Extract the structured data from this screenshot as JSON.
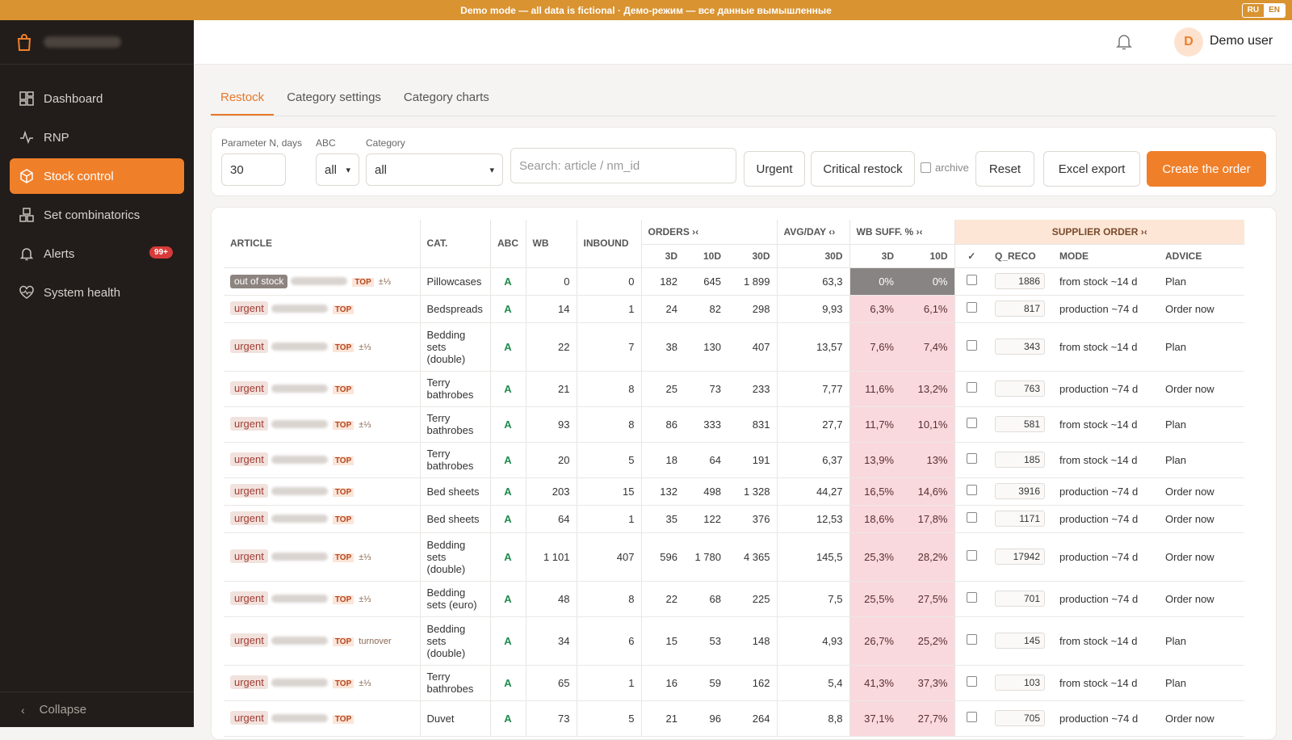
{
  "banner": {
    "text": "Demo mode — all data is fictional · Демо-режим — все данные вымышленные",
    "lang_ru": "RU",
    "lang_en": "EN"
  },
  "sidebar": {
    "items": [
      {
        "label": "Dashboard",
        "icon": "dashboard-icon"
      },
      {
        "label": "RNP",
        "icon": "activity-icon"
      },
      {
        "label": "Stock control",
        "icon": "box-icon",
        "active": true
      },
      {
        "label": "Set combinatorics",
        "icon": "boxes-icon"
      },
      {
        "label": "Alerts",
        "icon": "bell-icon",
        "badge": "99+"
      },
      {
        "label": "System health",
        "icon": "heart-pulse-icon"
      }
    ],
    "collapse": "Collapse"
  },
  "header": {
    "avatar_letter": "D",
    "user_name": "Demo user"
  },
  "tabs": [
    "Restock",
    "Category settings",
    "Category charts"
  ],
  "filters": {
    "param_label": "Parameter N, days",
    "param_value": "30",
    "abc_label": "ABC",
    "abc_value": "all",
    "category_label": "Category",
    "category_value": "all",
    "search_placeholder": "Search: article / nm_id",
    "urgent": "Urgent",
    "critical": "Critical restock",
    "archive": "archive",
    "reset": "Reset",
    "export": "Excel export",
    "create": "Create the order"
  },
  "table": {
    "headers": {
      "article": "ARTICLE",
      "cat": "CAT.",
      "abc": "ABC",
      "wb": "WB",
      "inbound": "INBOUND",
      "orders": "ORDERS ›‹",
      "avg": "AVG/DAY ‹›",
      "suff": "WB SUFF. % ›‹",
      "supplier": "SUPPLIER ORDER ›‹",
      "d3": "3D",
      "d10": "10D",
      "d30": "30D",
      "a30": "30D",
      "s3": "3D",
      "s10": "10D",
      "check": "✓",
      "qreco": "Q_RECO",
      "mode": "MODE",
      "advice": "ADVICE"
    },
    "rows": [
      {
        "status": "out of stock",
        "extra": "±⅓",
        "cat": "Pillowcases",
        "abc": "A",
        "wb": "0",
        "inbound": "0",
        "o3": "182",
        "o10": "645",
        "o30": "1 899",
        "avg": "63,3",
        "s3": "0%",
        "s10": "0%",
        "q": "1886",
        "mode": "from stock ~14 d",
        "advice": "Plan"
      },
      {
        "status": "urgent",
        "extra": "",
        "cat": "Bedspreads",
        "abc": "A",
        "wb": "14",
        "inbound": "1",
        "o3": "24",
        "o10": "82",
        "o30": "298",
        "avg": "9,93",
        "s3": "6,3%",
        "s10": "6,1%",
        "q": "817",
        "mode": "production ~74 d",
        "advice": "Order now"
      },
      {
        "status": "urgent",
        "extra": "±⅓",
        "cat": "Bedding sets (double)",
        "abc": "A",
        "wb": "22",
        "inbound": "7",
        "o3": "38",
        "o10": "130",
        "o30": "407",
        "avg": "13,57",
        "s3": "7,6%",
        "s10": "7,4%",
        "q": "343",
        "mode": "from stock ~14 d",
        "advice": "Plan"
      },
      {
        "status": "urgent",
        "extra": "",
        "cat": "Terry bathrobes",
        "abc": "A",
        "wb": "21",
        "inbound": "8",
        "o3": "25",
        "o10": "73",
        "o30": "233",
        "avg": "7,77",
        "s3": "11,6%",
        "s10": "13,2%",
        "q": "763",
        "mode": "production ~74 d",
        "advice": "Order now"
      },
      {
        "status": "urgent",
        "extra": "±⅓",
        "cat": "Terry bathrobes",
        "abc": "A",
        "wb": "93",
        "inbound": "8",
        "o3": "86",
        "o10": "333",
        "o30": "831",
        "avg": "27,7",
        "s3": "11,7%",
        "s10": "10,1%",
        "q": "581",
        "mode": "from stock ~14 d",
        "advice": "Plan"
      },
      {
        "status": "urgent",
        "extra": "",
        "cat": "Terry bathrobes",
        "abc": "A",
        "wb": "20",
        "inbound": "5",
        "o3": "18",
        "o10": "64",
        "o30": "191",
        "avg": "6,37",
        "s3": "13,9%",
        "s10": "13%",
        "q": "185",
        "mode": "from stock ~14 d",
        "advice": "Plan"
      },
      {
        "status": "urgent",
        "extra": "",
        "cat": "Bed sheets",
        "abc": "A",
        "wb": "203",
        "inbound": "15",
        "o3": "132",
        "o10": "498",
        "o30": "1 328",
        "avg": "44,27",
        "s3": "16,5%",
        "s10": "14,6%",
        "q": "3916",
        "mode": "production ~74 d",
        "advice": "Order now"
      },
      {
        "status": "urgent",
        "extra": "",
        "cat": "Bed sheets",
        "abc": "A",
        "wb": "64",
        "inbound": "1",
        "o3": "35",
        "o10": "122",
        "o30": "376",
        "avg": "12,53",
        "s3": "18,6%",
        "s10": "17,8%",
        "q": "1171",
        "mode": "production ~74 d",
        "advice": "Order now"
      },
      {
        "status": "urgent",
        "extra": "±⅓",
        "cat": "Bedding sets (double)",
        "abc": "A",
        "wb": "1 101",
        "inbound": "407",
        "o3": "596",
        "o10": "1 780",
        "o30": "4 365",
        "avg": "145,5",
        "s3": "25,3%",
        "s10": "28,2%",
        "q": "17942",
        "mode": "production ~74 d",
        "advice": "Order now"
      },
      {
        "status": "urgent",
        "extra": "±⅓",
        "cat": "Bedding sets (euro)",
        "abc": "A",
        "wb": "48",
        "inbound": "8",
        "o3": "22",
        "o10": "68",
        "o30": "225",
        "avg": "7,5",
        "s3": "25,5%",
        "s10": "27,5%",
        "q": "701",
        "mode": "production ~74 d",
        "advice": "Order now"
      },
      {
        "status": "urgent",
        "extra": "turnover",
        "cat": "Bedding sets (double)",
        "abc": "A",
        "wb": "34",
        "inbound": "6",
        "o3": "15",
        "o10": "53",
        "o30": "148",
        "avg": "4,93",
        "s3": "26,7%",
        "s10": "25,2%",
        "q": "145",
        "mode": "from stock ~14 d",
        "advice": "Plan"
      },
      {
        "status": "urgent",
        "extra": "±⅓",
        "cat": "Terry bathrobes",
        "abc": "A",
        "wb": "65",
        "inbound": "1",
        "o3": "16",
        "o10": "59",
        "o30": "162",
        "avg": "5,4",
        "s3": "41,3%",
        "s10": "37,3%",
        "q": "103",
        "mode": "from stock ~14 d",
        "advice": "Plan"
      },
      {
        "status": "urgent",
        "extra": "",
        "cat": "Duvet",
        "abc": "A",
        "wb": "73",
        "inbound": "5",
        "o3": "21",
        "o10": "96",
        "o30": "264",
        "avg": "8,8",
        "s3": "37,1%",
        "s10": "27,7%",
        "q": "705",
        "mode": "production ~74 d",
        "advice": "Order now"
      }
    ],
    "top_tag": "TOP"
  },
  "colors": {
    "accent": "#f07f2a",
    "banner": "#d99330",
    "sidebar": "#221d1a"
  }
}
